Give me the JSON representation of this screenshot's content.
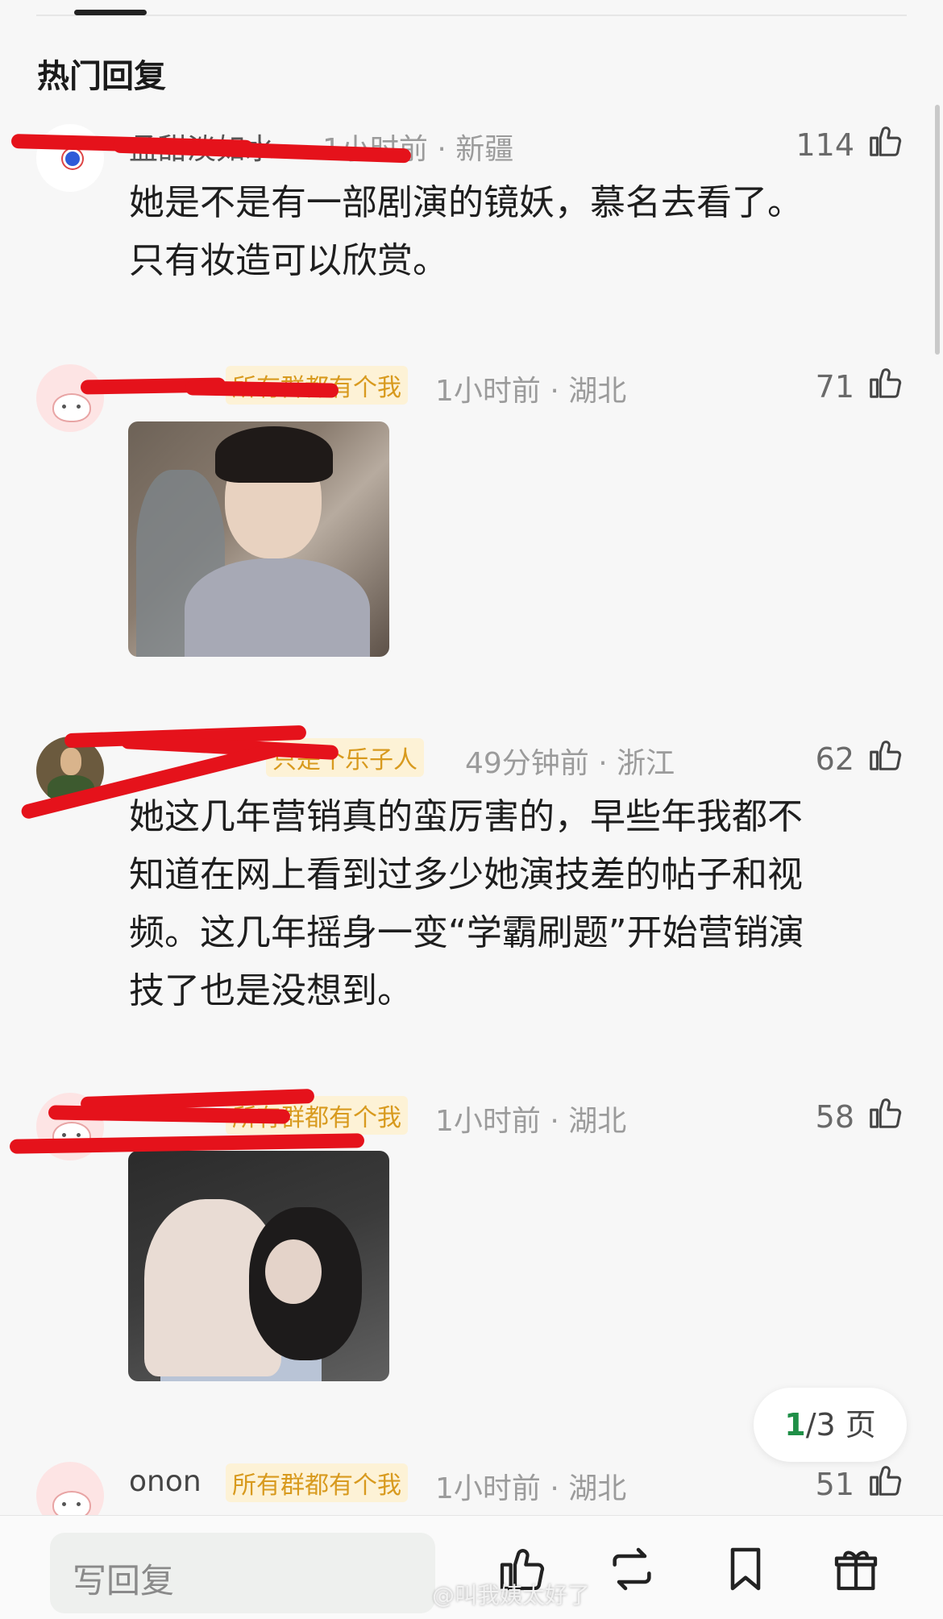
{
  "header": {
    "section_title": "热门回复"
  },
  "comments": [
    {
      "username": "孟甜淡如水",
      "meta": "1小时前 · 新疆",
      "likes": "114",
      "text_lines": [
        "她是不是有一部剧演的镜妖，慕名去看了。",
        "只有妆造可以欣赏。"
      ]
    },
    {
      "tag": "所有群都有个我",
      "meta": "1小时前 · 湖北",
      "likes": "71",
      "has_image": true
    },
    {
      "tag": "只是个乐子人",
      "meta": "49分钟前 · 浙江",
      "likes": "62",
      "text_lines": [
        "她这几年营销真的蛮厉害的，早些年我都不",
        "知道在网上看到过多少她演技差的帖子和视",
        "频。这几年摇身一变“学霸刷题”开始营销演",
        "技了也是没想到。"
      ]
    },
    {
      "tag": "所有群都有个我",
      "meta": "1小时前 · 湖北",
      "likes": "58",
      "has_image": true
    },
    {
      "username": "onon",
      "tag": "所有群都有个我",
      "meta": "1小时前 · 湖北",
      "likes": "51"
    }
  ],
  "pager": {
    "current": "1",
    "total_text": "/3 页"
  },
  "bottom_bar": {
    "reply_placeholder": "写回复",
    "icons": [
      "thumb-up-icon",
      "repost-icon",
      "bookmark-icon",
      "gift-icon"
    ]
  },
  "watermark": "@叫我姨太好了",
  "colors": {
    "accent_green": "#1f8f47",
    "tag_text": "#d89a1e",
    "tag_bg": "#fdf2d6",
    "redaction": "#e5121b"
  }
}
